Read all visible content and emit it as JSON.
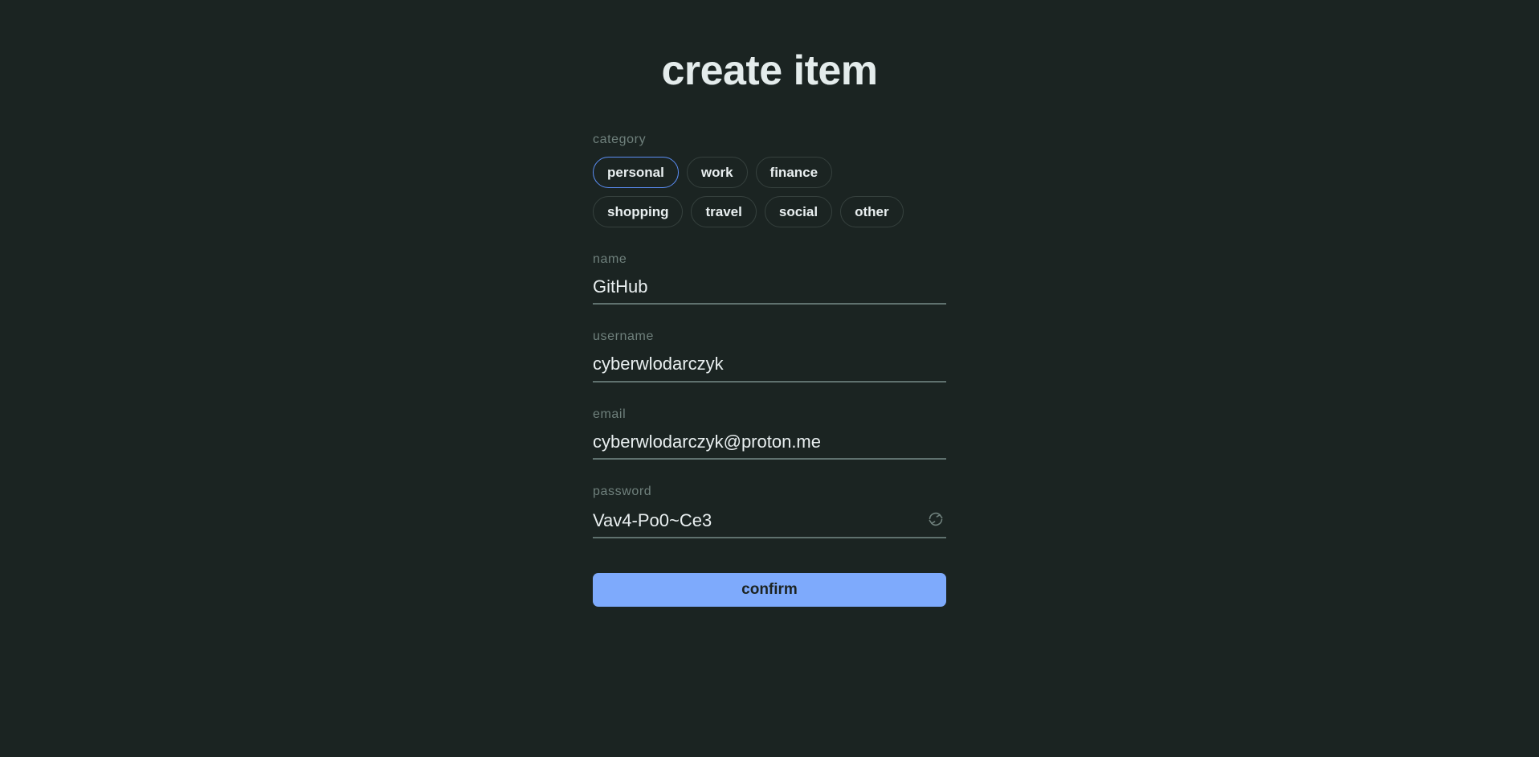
{
  "page": {
    "title": "create item",
    "background_color": "#1b2422",
    "accent_color": "#7eaafc",
    "selected_border_color": "#5b8ef5"
  },
  "category": {
    "label": "category",
    "selected": "personal",
    "options": [
      "personal",
      "work",
      "finance",
      "shopping",
      "travel",
      "social",
      "other"
    ]
  },
  "fields": {
    "name": {
      "label": "name",
      "value": "GitHub"
    },
    "username": {
      "label": "username",
      "value": "cyberwlodarczyk"
    },
    "email": {
      "label": "email",
      "value": "cyberwlodarczyk@proton.me"
    },
    "password": {
      "label": "password",
      "value": "Vav4-Po0~Ce3",
      "regenerate_icon": "refresh-icon"
    }
  },
  "actions": {
    "confirm_label": "confirm"
  }
}
